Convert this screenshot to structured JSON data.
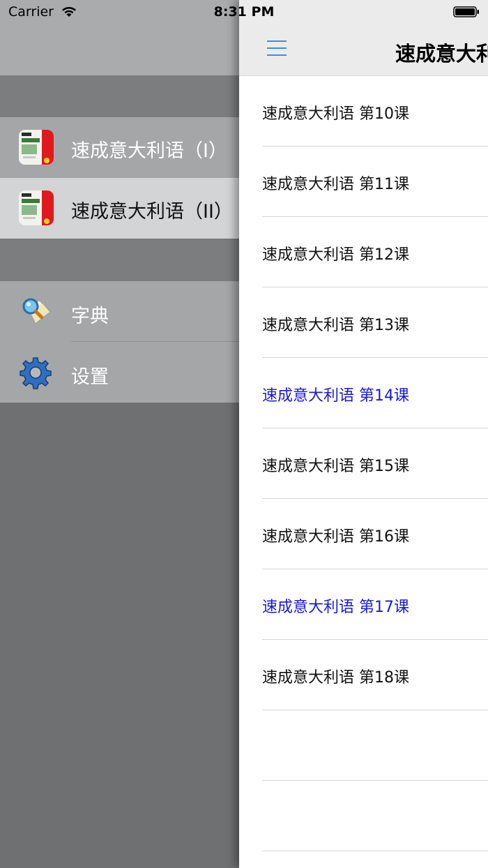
{
  "status_bar": {
    "carrier": "Carrier",
    "time": "8:31 PM"
  },
  "drawer": {
    "courses": [
      {
        "label": "速成意大利语（I）",
        "icon": "book-cover-icon",
        "selected": false
      },
      {
        "label": "速成意大利语（II）",
        "icon": "book-cover-icon",
        "selected": true
      }
    ],
    "tools": [
      {
        "label": "字典",
        "icon": "dictionary-magnifier-icon"
      },
      {
        "label": "设置",
        "icon": "gear-icon"
      }
    ]
  },
  "main": {
    "title": "速成意大利",
    "menu_icon": "hamburger-menu-icon",
    "accent_color": "#3d8fd6",
    "highlight_color": "#1a1ad6",
    "lessons": [
      {
        "label": "速成意大利语 第10课",
        "highlighted": false
      },
      {
        "label": "速成意大利语 第11课",
        "highlighted": false
      },
      {
        "label": "速成意大利语 第12课",
        "highlighted": false
      },
      {
        "label": "速成意大利语 第13课",
        "highlighted": false
      },
      {
        "label": "速成意大利语 第14课",
        "highlighted": true
      },
      {
        "label": "速成意大利语 第15课",
        "highlighted": false
      },
      {
        "label": "速成意大利语 第16课",
        "highlighted": false
      },
      {
        "label": "速成意大利语 第17课",
        "highlighted": true
      },
      {
        "label": "速成意大利语 第18课",
        "highlighted": false
      },
      {
        "label": "",
        "highlighted": false
      },
      {
        "label": "",
        "highlighted": false
      }
    ]
  }
}
